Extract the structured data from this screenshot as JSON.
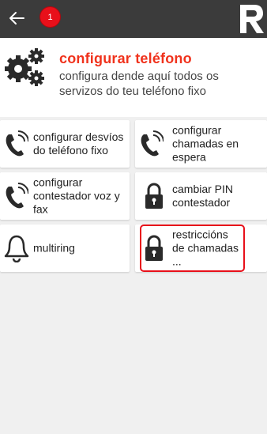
{
  "topbar": {
    "back_icon": "back-arrow-icon",
    "notification_count": "1",
    "logo_icon": "r-logo-icon"
  },
  "header": {
    "icon": "gears-icon",
    "title": "configurar teléfono",
    "subtitle": "configura dende aquí todos os servizos do teu teléfono fixo"
  },
  "menu": {
    "items": [
      {
        "label": "configurar desvíos do teléfono fixo",
        "icon": "phone-icon"
      },
      {
        "label": "configurar chamadas en espera",
        "icon": "phone-icon"
      },
      {
        "label": "configurar contestador voz y fax",
        "icon": "phone-icon"
      },
      {
        "label": "cambiar PIN contestador",
        "icon": "lock-icon"
      },
      {
        "label": "multiring",
        "icon": "bell-icon"
      },
      {
        "label": "restriccións de chamadas ...",
        "icon": "lock-icon"
      }
    ]
  },
  "colors": {
    "topbar": "#3b3b3b",
    "accent": "#f0321c",
    "badge": "#e8101a",
    "background": "#f0f0f0"
  }
}
